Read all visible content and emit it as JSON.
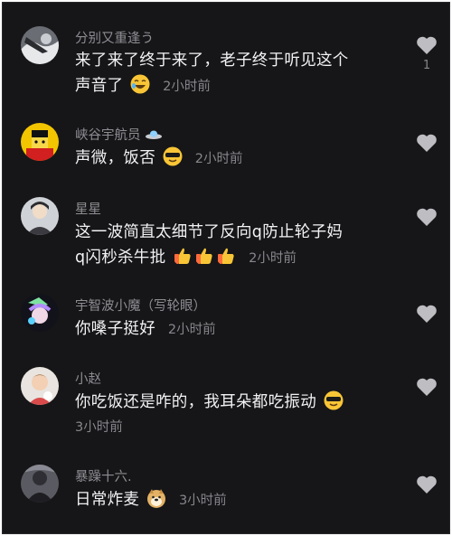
{
  "comments": [
    {
      "username": "分别又重逢う",
      "text_line1": "来了来了终于来了，老子终于听见这个",
      "text_line2": "声音了",
      "time": "2小时前",
      "like_count": "1",
      "emoji": "laughing-face"
    },
    {
      "username": "峡谷宇航员",
      "username_icon": "ufo-icon",
      "text": "声微，饭否",
      "time": "2小时前",
      "emoji": "cool-face-sunglasses"
    },
    {
      "username": "星星",
      "text_line1": "这一波简直太细节了反向q防止轮子妈",
      "text_line2": "q闪秒杀牛批",
      "time": "2小时前",
      "emoji": "thumbs-up"
    },
    {
      "username": "宇智波小魔（写轮眼）",
      "text": "你嗓子挺好",
      "time": "2小时前"
    },
    {
      "username": "小赵",
      "text": "你吃饭还是咋的，我耳朵都吃振动",
      "time": "3小时前",
      "emoji": "cool-face-sunglasses"
    },
    {
      "username": "暴躁十六.",
      "text": "日常炸麦",
      "time": "3小时前",
      "emoji": "doge"
    }
  ],
  "colors": {
    "background": "#161618",
    "username": "#8d8d93",
    "text": "#f2f2f4",
    "meta": "#86868c",
    "heart": "#bdbdc2"
  }
}
